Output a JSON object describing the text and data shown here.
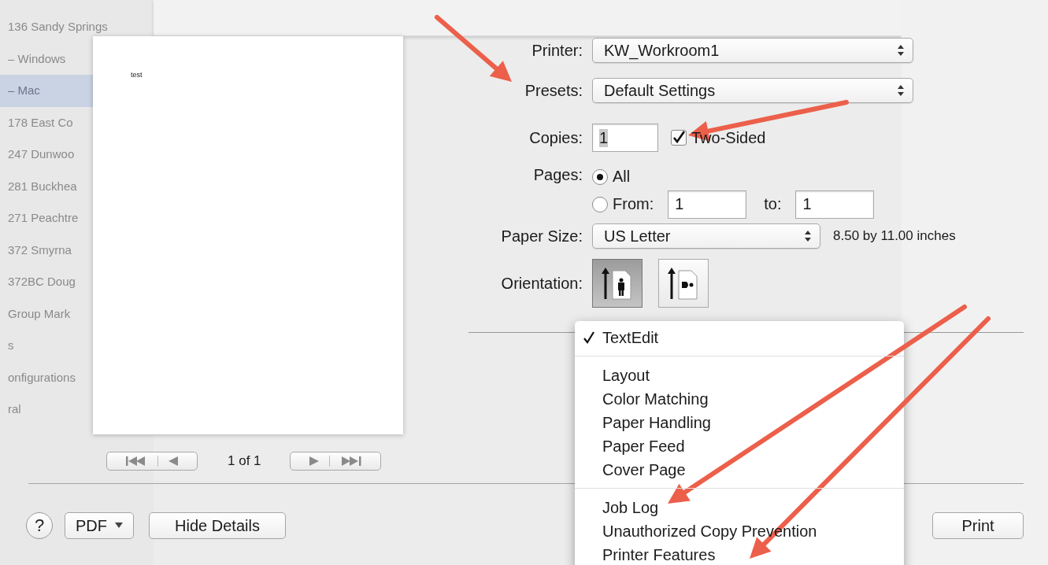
{
  "background": {
    "sidebar_items": [
      {
        "label": "136 Sandy Springs",
        "selected": false
      },
      {
        "label": "– Windows",
        "selected": false
      },
      {
        "label": "– Mac",
        "selected": true
      },
      {
        "label": "178 East Co",
        "selected": false
      },
      {
        "label": "247 Dunwoo",
        "selected": false
      },
      {
        "label": "281 Buckhea",
        "selected": false
      },
      {
        "label": "271 Peachtre",
        "selected": false
      },
      {
        "label": "372 Smyrna",
        "selected": false
      },
      {
        "label": "372BC Doug",
        "selected": false
      },
      {
        "label": "Group Mark",
        "selected": false
      },
      {
        "label": "s",
        "selected": false
      },
      {
        "label": "onfigurations",
        "selected": false
      },
      {
        "label": "ral",
        "selected": false
      }
    ]
  },
  "preview": {
    "page_text": "test",
    "page_indicator": "1 of 1"
  },
  "print_options": {
    "printer": {
      "label": "Printer:",
      "value": "KW_Workroom1"
    },
    "presets": {
      "label": "Presets:",
      "value": "Default Settings"
    },
    "copies": {
      "label": "Copies:",
      "value": "1"
    },
    "two_sided": {
      "label": "Two-Sided",
      "checked": true
    },
    "pages": {
      "label": "Pages:",
      "options": [
        {
          "label": "All",
          "selected": true
        },
        {
          "label": "From:",
          "selected": false
        }
      ],
      "from": "1",
      "to_label": "to:",
      "to": "1"
    },
    "paper_size": {
      "label": "Paper Size:",
      "value": "US Letter",
      "description": "8.50 by 11.00 inches"
    },
    "orientation": {
      "label": "Orientation:",
      "options": [
        {
          "kind": "portrait",
          "selected": true
        },
        {
          "kind": "landscape",
          "selected": false
        }
      ]
    }
  },
  "pane_menu": {
    "groups": [
      [
        {
          "label": "TextEdit",
          "checked": true
        }
      ],
      [
        {
          "label": "Layout",
          "checked": false
        },
        {
          "label": "Color Matching",
          "checked": false
        },
        {
          "label": "Paper Handling",
          "checked": false
        },
        {
          "label": "Paper Feed",
          "checked": false
        },
        {
          "label": "Cover Page",
          "checked": false
        }
      ],
      [
        {
          "label": "Job Log",
          "checked": false
        },
        {
          "label": "Unauthorized Copy Prevention",
          "checked": false
        },
        {
          "label": "Printer Features",
          "checked": false
        }
      ]
    ]
  },
  "buttons": {
    "help": "?",
    "pdf": "PDF",
    "hide_details": "Hide Details",
    "print": "Print"
  }
}
